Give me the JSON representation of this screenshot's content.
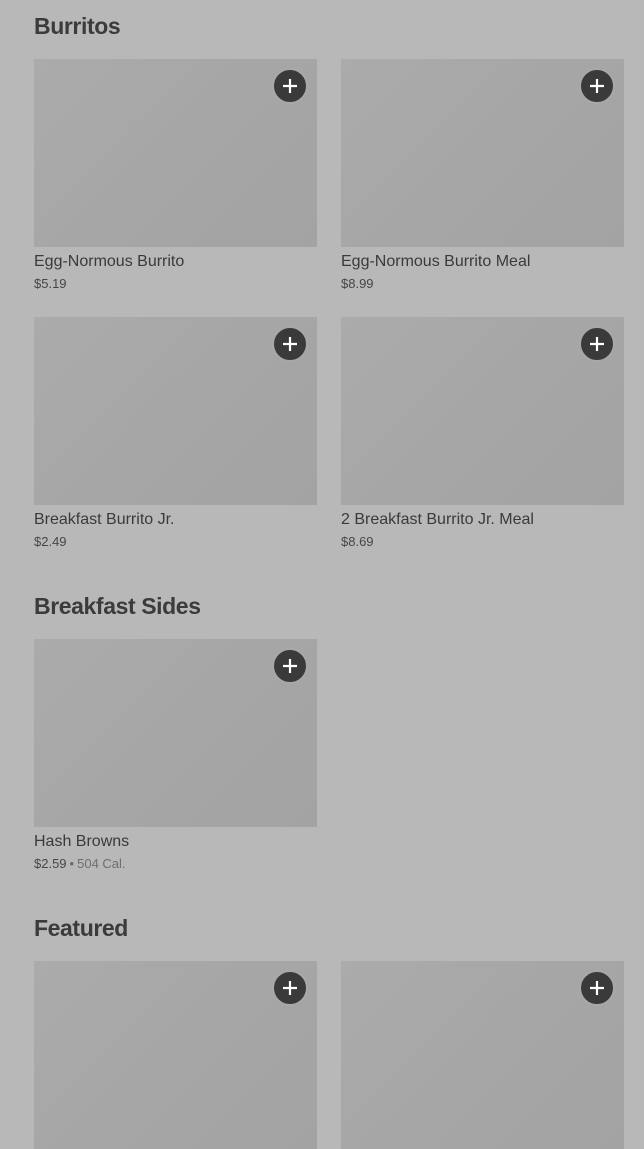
{
  "colors": {
    "background": "#b8b8b8",
    "image_placeholder": "#a7a7a7",
    "add_button": "#3a3a3a",
    "text": "#3a3a3a"
  },
  "sections": {
    "burritos": {
      "title": "Burritos",
      "items": [
        {
          "name": "Egg-Normous Burrito",
          "price": "$5.19",
          "add_icon": "plus-icon"
        },
        {
          "name": "Egg-Normous Burrito Meal",
          "price": "$8.99",
          "add_icon": "plus-icon"
        },
        {
          "name": "Breakfast Burrito Jr.",
          "price": "$2.49",
          "add_icon": "plus-icon"
        },
        {
          "name": "2 Breakfast Burrito Jr. Meal",
          "price": "$8.69",
          "add_icon": "plus-icon"
        }
      ]
    },
    "breakfast_sides": {
      "title": "Breakfast Sides",
      "items": [
        {
          "name": "Hash Browns",
          "price": "$2.59",
          "separator": "•",
          "calories": "504 Cal.",
          "add_icon": "plus-icon"
        }
      ]
    },
    "featured": {
      "title": "Featured",
      "items": [
        {
          "add_icon": "plus-icon"
        },
        {
          "add_icon": "plus-icon"
        }
      ]
    }
  }
}
